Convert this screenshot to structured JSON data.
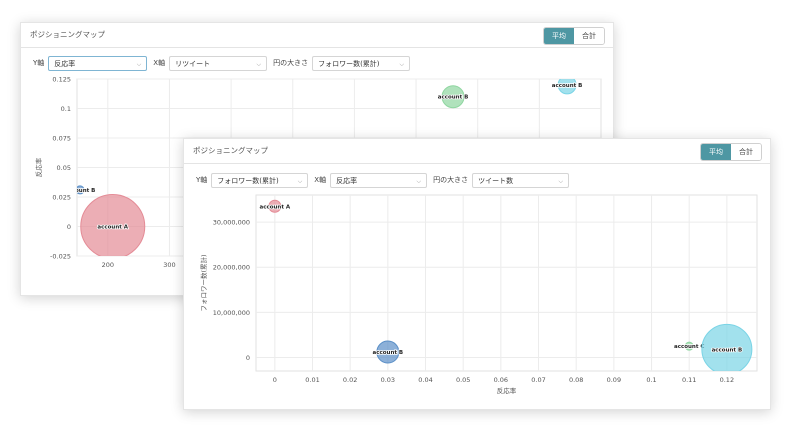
{
  "back": {
    "title": "ポジショニングマップ",
    "toggle": {
      "avg": "平均",
      "sum": "合計",
      "active": "avg"
    },
    "controls": {
      "y_label": "Y軸",
      "y_value": "反応率",
      "x_label": "X軸",
      "x_value": "リツイート",
      "size_label": "円の大きさ",
      "size_value": "フォロワー数(累計)"
    }
  },
  "front": {
    "title": "ポジショニングマップ",
    "toggle": {
      "avg": "平均",
      "sum": "合計",
      "active": "avg"
    },
    "controls": {
      "y_label": "Y軸",
      "y_value": "フォロワー数(累計)",
      "x_label": "X軸",
      "x_value": "反応率",
      "size_label": "円の大きさ",
      "size_value": "ツイート数"
    }
  },
  "chart_data": [
    {
      "type": "scatter",
      "xlabel": "",
      "ylabel": "反応率",
      "xlim": [
        150,
        1000
      ],
      "ylim": [
        -0.025,
        0.125
      ],
      "x_ticks": [
        "200",
        "300"
      ],
      "y_ticks": [
        "0.125",
        "0.1",
        "0.075",
        "0.05",
        "0.025",
        "0",
        "-0.025"
      ],
      "y_tick_values": [
        0.125,
        0.1,
        0.075,
        0.05,
        0.025,
        0,
        -0.025
      ],
      "x_tick_values": [
        200,
        300
      ],
      "points": [
        {
          "label": "account A",
          "x": 208,
          "y": 0,
          "size": 32,
          "color": "#e48b96"
        },
        {
          "label": "account B",
          "x": 155,
          "y": 0.031,
          "size": 4,
          "color": "#5b8fc7"
        },
        {
          "label": "account B",
          "x": 760,
          "y": 0.11,
          "size": 11,
          "color": "#8fd6a0"
        },
        {
          "label": "account B",
          "x": 945,
          "y": 0.12,
          "size": 9,
          "color": "#7ad4e6"
        }
      ],
      "grid": true
    },
    {
      "type": "scatter",
      "xlabel": "反応率",
      "ylabel": "フォロワー数(累計)",
      "xlim": [
        -0.005,
        0.128
      ],
      "ylim": [
        -3000000,
        36000000
      ],
      "x_ticks": [
        "0",
        "0.01",
        "0.02",
        "0.03",
        "0.04",
        "0.05",
        "0.06",
        "0.07",
        "0.08",
        "0.09",
        "0.1",
        "0.11",
        "0.12"
      ],
      "x_tick_values": [
        0,
        0.01,
        0.02,
        0.03,
        0.04,
        0.05,
        0.06,
        0.07,
        0.08,
        0.09,
        0.1,
        0.11,
        0.12
      ],
      "y_ticks": [
        "30,000,000",
        "20,000,000",
        "10,000,000",
        "0"
      ],
      "y_tick_values": [
        30000000,
        20000000,
        10000000,
        0
      ],
      "points": [
        {
          "label": "account A",
          "x": 0.0,
          "y": 33500000,
          "size": 6,
          "color": "#e48b96"
        },
        {
          "label": "account B",
          "x": 0.03,
          "y": 1200000,
          "size": 11,
          "color": "#5b8fc7"
        },
        {
          "label": "account C",
          "x": 0.11,
          "y": 2500000,
          "size": 4,
          "color": "#8fd6a0"
        },
        {
          "label": "account B",
          "x": 0.12,
          "y": 1800000,
          "size": 25,
          "color": "#7ad4e6"
        }
      ],
      "grid": true
    }
  ]
}
